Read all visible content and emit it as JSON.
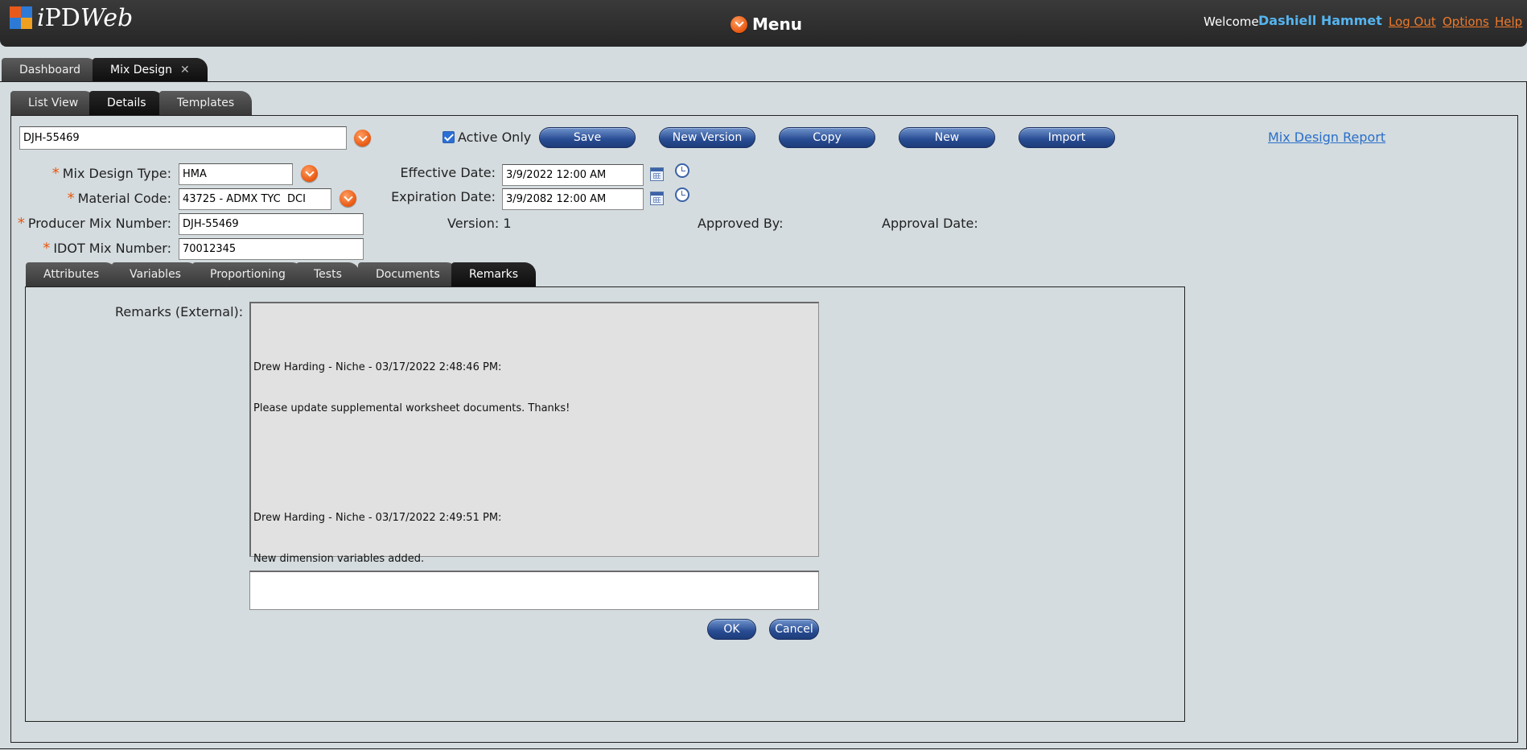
{
  "header": {
    "logo_text_i": "i",
    "logo_text_pd": "PD",
    "logo_text_web": "Web",
    "menu_label": "Menu",
    "welcome_label": "Welcome",
    "user_name": "Dashiell Hammet",
    "logout_label": "Log Out",
    "options_label": "Options",
    "help_label": "Help"
  },
  "top_tabs": [
    {
      "label": "Dashboard",
      "active": false
    },
    {
      "label": "Mix Design",
      "active": true,
      "close": "✕"
    }
  ],
  "view_tabs": [
    {
      "label": "List View",
      "active": false
    },
    {
      "label": "Details",
      "active": true
    },
    {
      "label": "Templates",
      "active": false
    }
  ],
  "toolbar": {
    "search_value": "DJH-55469",
    "active_only_label": "Active Only",
    "active_only_checked": true,
    "save_label": "Save",
    "new_version_label": "New Version",
    "copy_label": "Copy",
    "new_label": "New",
    "import_label": "Import",
    "report_link": "Mix Design Report"
  },
  "form": {
    "mix_design_type_label": "Mix Design Type:",
    "mix_design_type_value": "HMA",
    "material_code_label": "Material Code:",
    "material_code_value": "43725 - ADMX TYC  DCI",
    "producer_mix_number_label": "Producer Mix Number:",
    "producer_mix_number_value": "DJH-55469",
    "idot_mix_number_label": "IDOT Mix Number:",
    "idot_mix_number_value": "70012345",
    "effective_date_label": "Effective Date:",
    "effective_date_value": "3/9/2022 12:00 AM",
    "expiration_date_label": "Expiration Date:",
    "expiration_date_value": "3/9/2082 12:00 AM",
    "version_label": "Version:",
    "version_value": "1",
    "approved_by_label": "Approved By:",
    "approval_date_label": "Approval Date:"
  },
  "detail_tabs": [
    {
      "label": "Attributes",
      "active": false
    },
    {
      "label": "Variables",
      "active": false
    },
    {
      "label": "Proportioning",
      "active": false
    },
    {
      "label": "Tests",
      "active": false
    },
    {
      "label": "Documents",
      "active": false
    },
    {
      "label": "Remarks",
      "active": true
    }
  ],
  "remarks": {
    "label": "Remarks (External):",
    "entries": [
      {
        "header": "Drew Harding - Niche - 03/17/2022 2:48:46 PM:",
        "text": "Please update supplemental worksheet documents. Thanks!"
      },
      {
        "header": "Drew Harding - Niche - 03/17/2022 2:49:51 PM:",
        "text": "New dimension variables added."
      }
    ],
    "new_remark_value": "",
    "ok_label": "OK",
    "cancel_label": "Cancel"
  },
  "colors": {
    "accent_orange": "#e8570f",
    "user_blue": "#55b5f0",
    "button_blue": "#284c92"
  }
}
